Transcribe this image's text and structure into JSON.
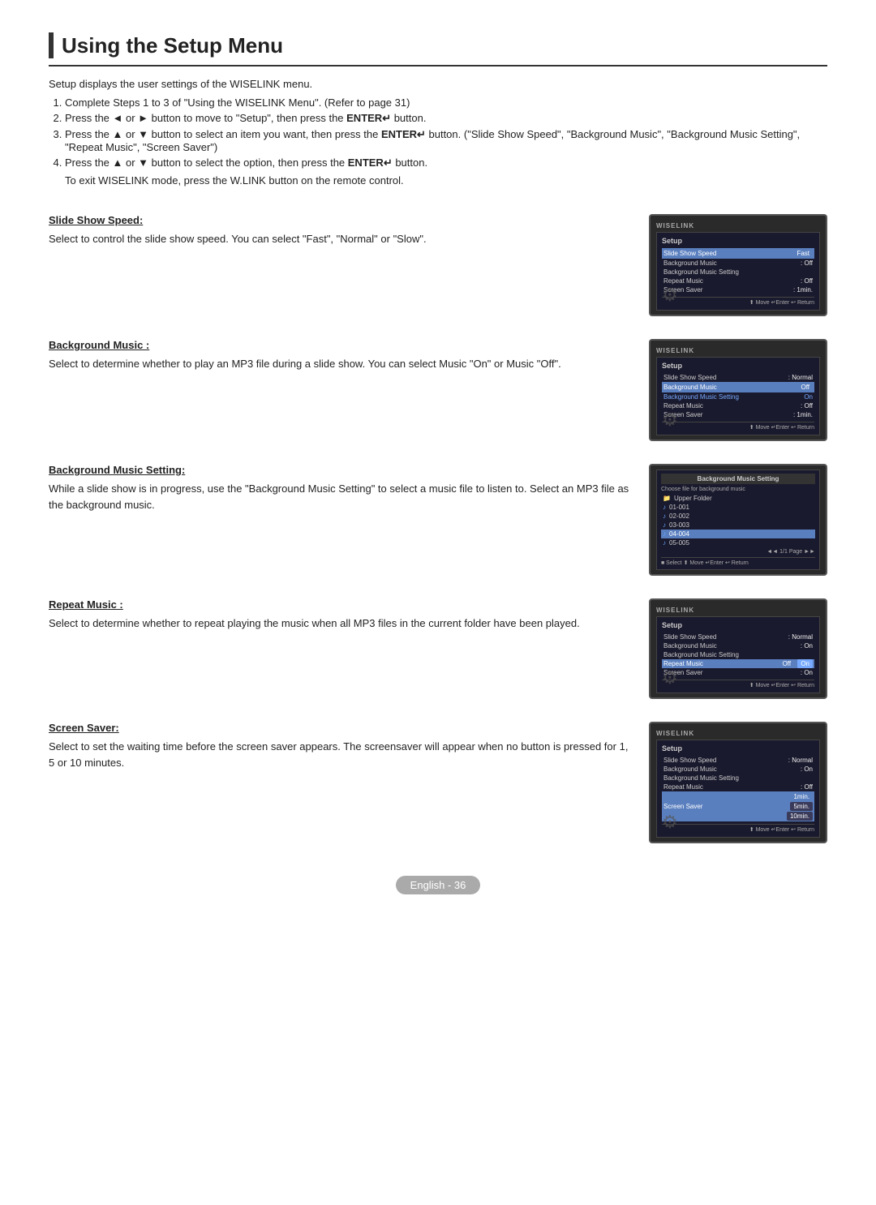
{
  "page": {
    "title": "Using the Setup Menu",
    "intro": "Setup displays the user settings of the WISELINK menu.",
    "steps": [
      "Complete Steps 1 to 3 of \"Using the WISELINK Menu\". (Refer to page 31)",
      "Press the ◄ or ► button to move to \"Setup\", then press the ENTER button.",
      "Press the ▲ or ▼ button to select an item you want, then press the ENTER button. (\"Slide Show Speed\", \"Background Music\", \"Background Music Setting\", \"Repeat Music\", \"Screen Saver\")",
      "Press the ▲ or ▼ button to select the option, then press the ENTER button.",
      "To exit WISELINK mode, press the W.LINK button on the remote control."
    ]
  },
  "sections": [
    {
      "id": "slide-show-speed",
      "heading": "Slide Show Speed:",
      "body": "Select to control the slide show speed. You can select \"Fast\", \"Normal\" or \"Slow\".",
      "screen": {
        "brand": "WISELINK",
        "label": "Setup",
        "rows": [
          {
            "label": "Slide Show Speed",
            "value": "Fast",
            "highlighted": true
          },
          {
            "label": "Background Music",
            "value": "Off"
          },
          {
            "label": "Background Music Setting",
            "value": ""
          },
          {
            "label": "Repeat Music",
            "value": ": Off"
          },
          {
            "label": "Screen Saver",
            "value": ": 1min."
          }
        ],
        "footer": "⬆ Move  ↵Enter  ↩ Return"
      }
    },
    {
      "id": "background-music",
      "heading": "Background Music :",
      "body": "Select to determine whether to play an MP3 file during a slide show. You can select Music \"On\" or Music \"Off\".",
      "screen": {
        "brand": "WISELINK",
        "label": "Setup",
        "rows": [
          {
            "label": "Slide Show Speed",
            "value": ": Normal"
          },
          {
            "label": "Background Music",
            "value": "Off",
            "highlighted": true
          },
          {
            "label": "Background Music Setting",
            "value": "On"
          },
          {
            "label": "Repeat Music",
            "value": ": Off"
          },
          {
            "label": "Screen Saver",
            "value": ": 1min."
          }
        ],
        "footer": "⬆ Move  ↵Enter  ↩ Return"
      }
    },
    {
      "id": "background-music-setting",
      "heading": "Background Music Setting:",
      "body": "While a slide show is in progress, use the \"Background Music Setting\" to select a music file to listen to. Select an MP3 file as the background music.",
      "screen": {
        "type": "bms",
        "title": "Background Music Setting",
        "subtitle": "Choose file for background music",
        "files": [
          {
            "label": "Upper Folder",
            "icon": "📁",
            "selected": false
          },
          {
            "label": "01-001",
            "icon": "♪",
            "selected": false
          },
          {
            "label": "02-002",
            "icon": "♪",
            "selected": false
          },
          {
            "label": "03-003",
            "icon": "♪",
            "selected": false
          },
          {
            "label": "04-004",
            "icon": "♪",
            "selected": true
          },
          {
            "label": "05-005",
            "icon": "♪",
            "selected": false
          }
        ],
        "pagination": "◄◄ 1/1 Page ►►",
        "footer": "■ Select  ⬆ Move  ↵Enter  ↩ Return"
      }
    },
    {
      "id": "repeat-music",
      "heading": "Repeat Music :",
      "body": "Select to determine whether to repeat playing the music when all MP3 files in the current folder have been played.",
      "screen": {
        "brand": "WISELINK",
        "label": "Setup",
        "rows": [
          {
            "label": "Slide Show Speed",
            "value": ": Normal"
          },
          {
            "label": "Background Music",
            "value": ": On"
          },
          {
            "label": "Background Music Setting",
            "value": ""
          },
          {
            "label": "Repeat Music",
            "value": "Off",
            "highlighted": true
          },
          {
            "label": "Screen Saver",
            "value": ": On"
          }
        ],
        "footer": "⬆ Move  ↵Enter  ↩ Return",
        "highlight2": "On"
      }
    },
    {
      "id": "screen-saver",
      "heading": "Screen Saver:",
      "body": "Select to set the waiting time before the screen saver appears. The screensaver will appear when no button is pressed for 1, 5 or 10 minutes.",
      "screen": {
        "brand": "WISELINK",
        "label": "Setup",
        "rows": [
          {
            "label": "Slide Show Speed",
            "value": ": Normal"
          },
          {
            "label": "Background Music",
            "value": ": On"
          },
          {
            "label": "Background Music Setting",
            "value": ""
          },
          {
            "label": "Repeat Music",
            "value": ": Off"
          },
          {
            "label": "Screen Saver",
            "value": "1min.",
            "highlighted": true
          }
        ],
        "footer": "⬆ Move  ↵Enter  ↩ Return",
        "extraOptions": [
          "5min.",
          "10min."
        ]
      }
    }
  ],
  "footer": {
    "text": "English - 36"
  }
}
